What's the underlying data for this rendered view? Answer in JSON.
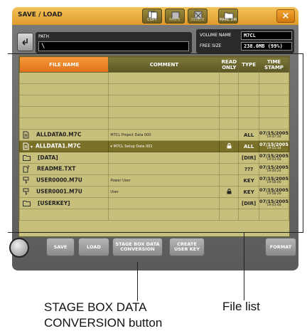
{
  "window": {
    "title": "SAVE / LOAD"
  },
  "toolbar": {
    "copy": "COPY",
    "paste": "PASTE",
    "delete": "DELETE",
    "make_dir": "MAKE DIR",
    "close": "×"
  },
  "path": {
    "label": "PATH",
    "value": "\\"
  },
  "volume": {
    "name_label": "VOLUME NAME",
    "name_value": "M7CL",
    "free_label": "FREE SIZE",
    "free_value": "238.0MB (99%)"
  },
  "columns": {
    "file_name": "FILE NAME",
    "comment": "COMMENT",
    "read_only": "READ ONLY",
    "type": "TYPE",
    "time_stamp": "TIME STAMP"
  },
  "files": [
    {
      "name": "ALLDATA0.M7C",
      "comment": "M7CL Project Data 000",
      "type": "ALL",
      "date": "07/15/2005",
      "time": "19:47:34"
    },
    {
      "name": "ALLDATA1.M7C",
      "comment": "M7CL Setup Data 001",
      "type": "ALL",
      "date": "07/15/2005",
      "time": "19:51:14"
    },
    {
      "name": "[DATA]",
      "comment": "",
      "type": "[DIR]",
      "date": "07/15/2005",
      "time": "19:43:48"
    },
    {
      "name": "README.TXT",
      "comment": "",
      "type": "???",
      "date": "07/15/2005",
      "time": "19:44:24"
    },
    {
      "name": "USER0000.M7U",
      "comment": "Power User",
      "type": "KEY",
      "date": "07/15/2005",
      "time": "19:58:00"
    },
    {
      "name": "USER0001.M7U",
      "comment": "User",
      "type": "KEY",
      "date": "07/15/2005",
      "time": "19:58:26"
    },
    {
      "name": "[USERKEY]",
      "comment": "",
      "type": "[DIR]",
      "date": "07/15/2005",
      "time": "19:43:48"
    }
  ],
  "bottom": {
    "save": "SAVE",
    "load": "LOAD",
    "stage_box": "STAGE BOX DATA CONVERSION",
    "create_user_key": "CREATE USER KEY",
    "format": "FORMAT"
  },
  "callouts": {
    "stage_box": "STAGE BOX DATA\nCONVERSION button",
    "file_list": "File list"
  }
}
